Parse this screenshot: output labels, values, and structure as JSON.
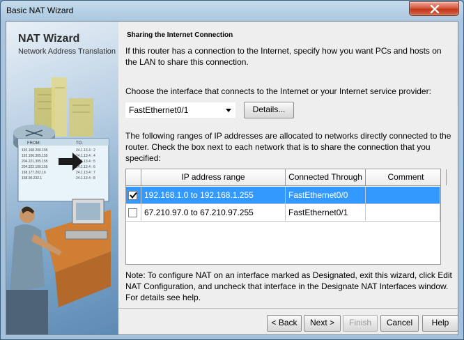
{
  "window": {
    "title": "Basic NAT Wizard"
  },
  "side": {
    "title": "NAT Wizard",
    "subtitle": "Network Address Translation"
  },
  "main": {
    "heading": "Sharing the Internet Connection",
    "intro": "If this router has a connection to the Internet, specify how you want PCs and hosts on the LAN to share this connection.",
    "choose_label": "Choose the interface that connects to the Internet or your Internet service provider:",
    "interface_select": {
      "value": "FastEthernet0/1"
    },
    "details_button": "Details...",
    "ranges_text": "The following ranges of IP addresses are allocated to networks directly connected to the router. Check the box next to each network that is to share the connection that you specified:",
    "table": {
      "headers": [
        "IP address range",
        "Connected Through",
        "Comment"
      ],
      "rows": [
        {
          "checked": true,
          "range": "192.168.1.0 to 192.168.1.255",
          "interface": "FastEthernet0/0",
          "comment": ""
        },
        {
          "checked": false,
          "range": "67.210.97.0 to 67.210.97.255",
          "interface": "FastEthernet0/1",
          "comment": ""
        }
      ]
    },
    "note": "Note: To configure NAT on an interface marked as Designated, exit this wizard, click Edit NAT Configuration, and uncheck that interface in the Designate NAT Interfaces window. For details see help."
  },
  "buttons": {
    "back": "< Back",
    "next": "Next >",
    "finish": "Finish",
    "cancel": "Cancel",
    "help": "Help"
  },
  "illustration": {
    "table_headers": [
      "FROM:",
      "TO:"
    ],
    "from": [
      "192.168.200.155",
      "192.106.305.155",
      "204.221.305.155",
      "204.322.100.155",
      "168.177.202.16",
      "168.90.232.1"
    ],
    "to": [
      "24.1.13.4 : 2",
      "24.1.13.4 : 4",
      "24.1.13.4 : 5",
      "24.1.13.4 : 6",
      "24.1.13.4 : 7",
      "24.1.13.4 : 8"
    ]
  },
  "colors": {
    "selection": "#3399ff",
    "close_button": "#c8432a"
  }
}
